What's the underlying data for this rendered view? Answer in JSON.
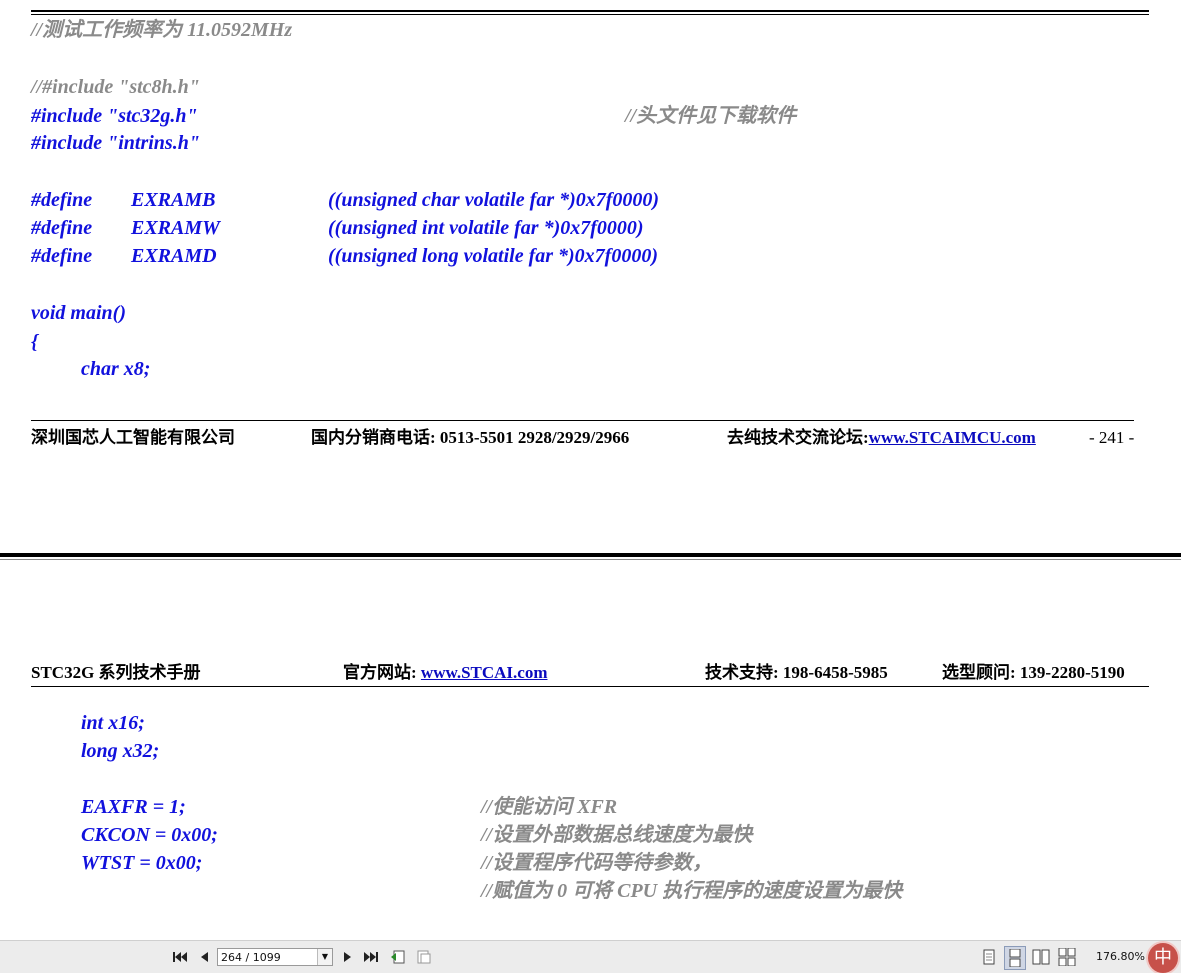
{
  "top_page": {
    "comment_freq": "//测试工作频率为 11.0592MHz",
    "include_stc8h": "//#include \"stc8h.h\"",
    "include_stc32g": "#include \"stc32g.h\"",
    "include_comment": "//头文件见下载软件",
    "include_intrins": "#include \"intrins.h\"",
    "defines": [
      {
        "keyword": "#define",
        "name": "EXRAMB",
        "value": "((unsigned char volatile far *)0x7f0000)"
      },
      {
        "keyword": "#define",
        "name": "EXRAMW",
        "value": "((unsigned int volatile far *)0x7f0000)"
      },
      {
        "keyword": "#define",
        "name": "EXRAMD",
        "value": "((unsigned long volatile far *)0x7f0000)"
      }
    ],
    "main_decl": "void main()",
    "open_brace": "{",
    "var_x8": "char x8;",
    "footer": {
      "company": "深圳国芯人工智能有限公司",
      "phone": "国内分销商电话: 0513-5501 2928/2929/2966",
      "forum_label": "去纯技术交流论坛:",
      "forum_url": "www.STCAIMCU.com",
      "page_number": "- 241 -"
    }
  },
  "bottom_page": {
    "header": {
      "manual": "STC32G 系列技术手册",
      "site_label": "官方网站: ",
      "site_url": "www.STCAI.com",
      "support": "技术支持: 198-6458-5985",
      "advisor": "选型顾问: 139-2280-5190"
    },
    "var_x16": "int x16;",
    "var_x32": "long x32;",
    "lines": [
      {
        "code": "EAXFR = 1;",
        "comment": "//使能访问 XFR"
      },
      {
        "code": "CKCON = 0x00;",
        "comment": "//设置外部数据总线速度为最快"
      },
      {
        "code": "WTST = 0x00;",
        "comment": "//设置程序代码等待参数，"
      },
      {
        "code": "",
        "comment": "//赋值为 0 可将 CPU 执行程序的速度设置为最快"
      }
    ]
  },
  "statusbar": {
    "page_field": "264 / 1099",
    "zoom": "176.80%",
    "ime": "中",
    "icons": [
      "first-page-icon",
      "prev-page-icon",
      "next-page-icon",
      "last-page-icon",
      "back-view-icon",
      "forward-view-icon",
      "single-page-icon",
      "continuous-page-icon",
      "facing-page-icon",
      "facing-continuous-icon"
    ]
  }
}
